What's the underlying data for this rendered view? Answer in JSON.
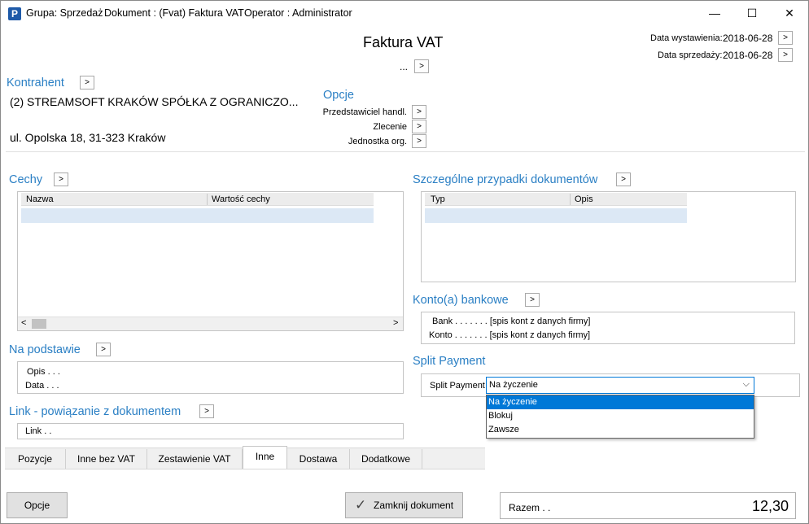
{
  "titlebar": {
    "icon_letter": "P",
    "group": "Grupa: Sprzedaż",
    "document": "Dokument : (Fvat) Faktura VAT",
    "operator": "Operator : Administrator",
    "minimize": "—",
    "maximize": "☐",
    "close": "✕"
  },
  "header": {
    "title": "Faktura VAT",
    "number": "...",
    "date_issue_label": "Data wystawienia:",
    "date_issue_value": "2018-06-28",
    "date_sale_label": "Data sprzedaży:",
    "date_sale_value": "2018-06-28"
  },
  "contractor": {
    "heading": "Kontrahent",
    "name": "(2) STREAMSOFT KRAKÓW SPÓŁKA Z OGRANICZO...",
    "address": "ul. Opolska 18, 31-323 Kraków"
  },
  "options": {
    "heading": "Opcje",
    "items": [
      "Przedstawiciel handl.",
      "Zlecenie",
      "Jednostka org."
    ]
  },
  "cechy": {
    "heading": "Cechy",
    "columns": [
      "Nazwa",
      "Wartość cechy"
    ],
    "scroll_left": "<",
    "scroll_right": ">"
  },
  "special_cases": {
    "heading": "Szczególne przypadki dokumentów",
    "columns": [
      "Typ",
      "Opis"
    ]
  },
  "bank": {
    "heading": "Konto(a) bankowe",
    "bank_line": "Bank . . . . . . . [spis kont z danych firmy]",
    "account_line": "Konto . . . . . . . [spis kont z danych firmy]"
  },
  "basis": {
    "heading": "Na podstawie",
    "opis": "Opis . . .",
    "data": "Data . . ."
  },
  "split_payment": {
    "heading": "Split Payment",
    "label": "Split Payment",
    "value": "Na życzenie",
    "options": [
      "Na życzenie",
      "Blokuj",
      "Zawsze"
    ],
    "selected_index": 0
  },
  "link": {
    "heading": "Link - powiązanie z dokumentem",
    "field": "Link . ."
  },
  "tabs": [
    "Pozycje",
    "Inne bez VAT",
    "Zestawienie VAT",
    "Inne",
    "Dostawa",
    "Dodatkowe"
  ],
  "active_tab": "Inne",
  "footer": {
    "options_button": "Opcje",
    "close_doc_button": "Zamknij dokument",
    "total_label": "Razem . .",
    "total_value": "12,30"
  }
}
